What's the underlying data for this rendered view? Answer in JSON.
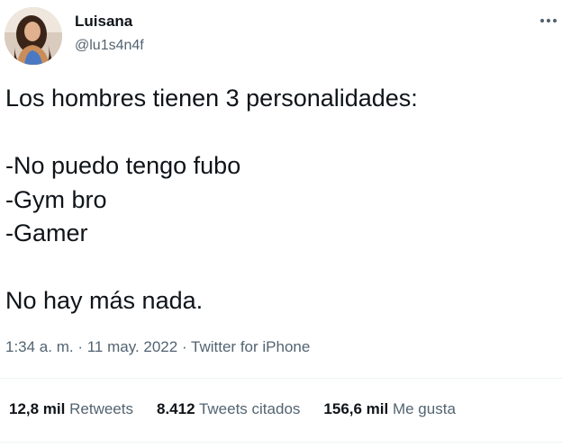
{
  "author": {
    "display_name": "Luisana",
    "handle": "@lu1s4n4f"
  },
  "tweet": {
    "lines": [
      "Los hombres tienen 3 personalidades:",
      "",
      "-No puedo tengo fubo",
      "-Gym bro",
      "-Gamer",
      "",
      "No hay más nada."
    ]
  },
  "meta": {
    "time": "1:34 a. m.",
    "separator1": " · ",
    "date": "11 may. 2022",
    "separator2": " · ",
    "source": "Twitter for iPhone"
  },
  "stats": {
    "retweets_count": "12,8 mil",
    "retweets_label": "Retweets",
    "quotes_count": "8.412",
    "quotes_label": "Tweets citados",
    "likes_count": "156,6 mil",
    "likes_label": "Me gusta"
  },
  "icons": {
    "more": "more-horizontal-icon",
    "avatar": "profile-photo"
  },
  "colors": {
    "text_primary": "#0f1419",
    "text_secondary": "#536471",
    "divider": "#eff3f4"
  }
}
